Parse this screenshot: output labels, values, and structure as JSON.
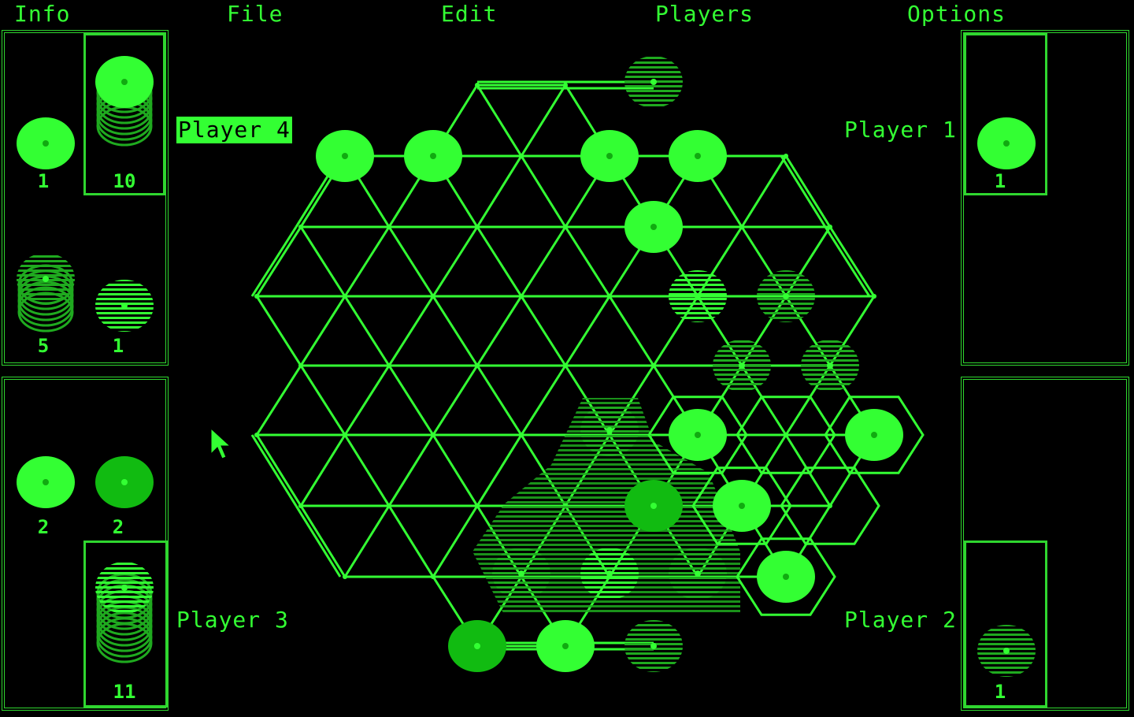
{
  "menu": {
    "info": "Info",
    "file": "File",
    "edit": "Edit",
    "players": "Players",
    "options": "Options"
  },
  "players": {
    "p4": {
      "label": "Player 4",
      "active": true,
      "reserve": [
        {
          "count": "1"
        },
        {
          "count": "10"
        },
        {
          "count": "5"
        },
        {
          "count": "1"
        }
      ]
    },
    "p3": {
      "label": "Player 3",
      "reserve": [
        {
          "count": "2"
        },
        {
          "count": "2"
        },
        {
          "count": "11"
        }
      ]
    },
    "p1": {
      "label": "Player 1",
      "reserve": [
        {
          "count": "1"
        }
      ]
    },
    "p2": {
      "label": "Player 2",
      "reserve": [
        {
          "count": "1"
        }
      ]
    }
  },
  "colors": {
    "phosphor": "#33ff33",
    "dim": "#1faa1f",
    "bg": "#000000"
  }
}
